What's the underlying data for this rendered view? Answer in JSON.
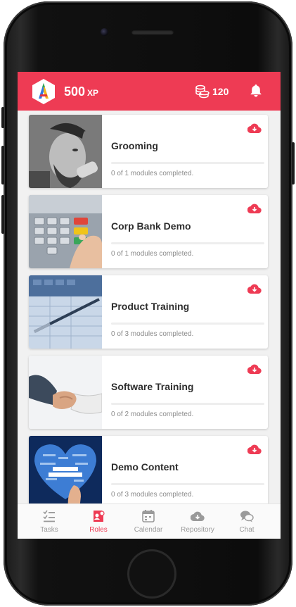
{
  "header": {
    "xp_value": "500",
    "xp_unit": "XP",
    "coins": "120",
    "logo_icon": "app-logo-a",
    "coins_icon": "coins-stack-icon",
    "bell_icon": "bell-icon"
  },
  "modules": [
    {
      "title": "Grooming",
      "status": "0 of 1 modules completed.",
      "completed": 0,
      "total": 1,
      "image": "barber-grooming-photo",
      "action_icon": "cloud-download-icon"
    },
    {
      "title": "Corp Bank Demo",
      "status": "0 of 1 modules completed.",
      "completed": 0,
      "total": 1,
      "image": "atm-keypad-photo",
      "action_icon": "cloud-download-icon"
    },
    {
      "title": "Product Training",
      "status": "0 of 3 modules completed.",
      "completed": 0,
      "total": 3,
      "image": "calculator-pen-photo",
      "action_icon": "cloud-download-icon"
    },
    {
      "title": "Software Training",
      "status": "0 of 2 modules completed.",
      "completed": 0,
      "total": 2,
      "image": "handshake-photo",
      "action_icon": "cloud-download-icon"
    },
    {
      "title": "Demo Content",
      "status": "0 of 3 modules completed.",
      "completed": 0,
      "total": 3,
      "image": "life-insurance-heart-photo",
      "action_icon": "cloud-download-icon"
    }
  ],
  "nav": [
    {
      "label": "Tasks",
      "icon": "checklist-icon",
      "active": false
    },
    {
      "label": "Roles",
      "icon": "roles-badge-icon",
      "active": true
    },
    {
      "label": "Calendar",
      "icon": "calendar-icon",
      "active": false
    },
    {
      "label": "Repository",
      "icon": "cloud-download-icon",
      "active": false
    },
    {
      "label": "Chat",
      "icon": "chat-bubbles-icon",
      "active": false
    }
  ],
  "colors": {
    "brand": "#ee3b54",
    "nav_inactive": "#9a9a9a"
  }
}
